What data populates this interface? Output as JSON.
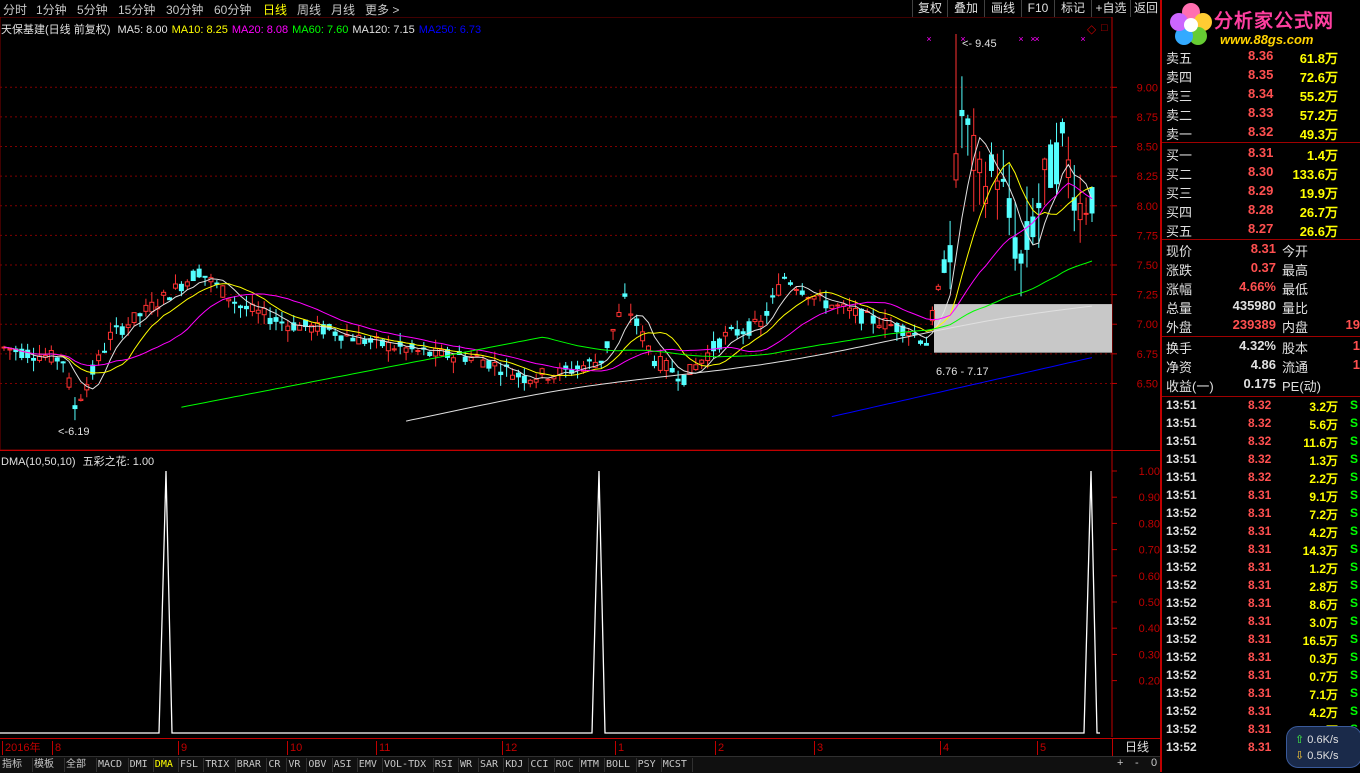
{
  "toolbar": {
    "periods": [
      "分时",
      "1分钟",
      "5分钟",
      "15分钟",
      "30分钟",
      "60分钟",
      "日线",
      "周线",
      "月线",
      "更多 >"
    ],
    "active_period": "日线",
    "buttons": [
      "复权",
      "叠加",
      "画线",
      "F10",
      "标记",
      "+自选",
      "返回"
    ]
  },
  "logo": {
    "title": "分析家公式网",
    "url_text": "www.88gs.com"
  },
  "main_title": {
    "stock": "天保基建(日线 前复权)",
    "ma": [
      {
        "label": "MA5: 8.00",
        "color": "#e0e0e0"
      },
      {
        "label": "MA10: 8.25",
        "color": "#ffff00"
      },
      {
        "label": "MA20: 8.08",
        "color": "#ff00ff"
      },
      {
        "label": "MA60: 7.60",
        "color": "#00ff00"
      },
      {
        "label": "MA120: 7.15",
        "color": "#e0e0e0"
      },
      {
        "label": "MA250: 6.73",
        "color": "#0000ff"
      }
    ]
  },
  "price_axis": [
    "9.00",
    "8.75",
    "8.50",
    "8.25",
    "8.00",
    "7.75",
    "7.50",
    "7.25",
    "7.00",
    "6.75",
    "6.50"
  ],
  "annotations": {
    "high": "9.45",
    "low": "6.19",
    "range": "6.76 - 7.17"
  },
  "indicator": {
    "title": "DMA(10,50,10)",
    "value_label": "五彩之花: 1.00",
    "axis": [
      "1.00",
      "0.90",
      "0.80",
      "0.70",
      "0.60",
      "0.50",
      "0.40",
      "0.30",
      "0.20"
    ]
  },
  "date_axis": [
    "2016年",
    "8",
    "9",
    "10",
    "11",
    "12",
    "1",
    "2",
    "3",
    "4",
    "5"
  ],
  "period_label": "日线",
  "quotes": {
    "asks": [
      {
        "label": "卖五",
        "price": "8.36",
        "vol": "61.8万"
      },
      {
        "label": "卖四",
        "price": "8.35",
        "vol": "72.6万"
      },
      {
        "label": "卖三",
        "price": "8.34",
        "vol": "55.2万"
      },
      {
        "label": "卖二",
        "price": "8.33",
        "vol": "57.2万"
      },
      {
        "label": "卖一",
        "price": "8.32",
        "vol": "49.3万"
      }
    ],
    "bids": [
      {
        "label": "买一",
        "price": "8.31",
        "vol": "1.4万"
      },
      {
        "label": "买二",
        "price": "8.30",
        "vol": "133.6万"
      },
      {
        "label": "买三",
        "price": "8.29",
        "vol": "19.9万"
      },
      {
        "label": "买四",
        "price": "8.28",
        "vol": "26.7万"
      },
      {
        "label": "买五",
        "price": "8.27",
        "vol": "26.6万"
      }
    ],
    "stats": [
      {
        "l1": "现价",
        "v1": "8.31",
        "l2": "今开",
        "v2": ""
      },
      {
        "l1": "涨跌",
        "v1": "0.37",
        "l2": "最高",
        "v2": ""
      },
      {
        "l1": "涨幅",
        "v1": "4.66%",
        "l2": "最低",
        "v2": ""
      },
      {
        "l1": "总量",
        "v1": "435980",
        "l2": "量比",
        "v2": ""
      },
      {
        "l1": "外盘",
        "v1": "239389",
        "l2": "内盘",
        "v2": "19"
      }
    ],
    "info": [
      {
        "l1": "换手",
        "v1": "4.32%",
        "l2": "股本",
        "v2": "1"
      },
      {
        "l1": "净资",
        "v1": "4.86",
        "l2": "流通",
        "v2": "1"
      },
      {
        "l1": "收益(一)",
        "v1": "0.175",
        "l2": "PE(动)",
        "v2": ""
      }
    ]
  },
  "ticks": [
    {
      "time": "13:51",
      "price": "8.32",
      "vol": "3.2万",
      "flag": "S"
    },
    {
      "time": "13:51",
      "price": "8.32",
      "vol": "5.6万",
      "flag": "S"
    },
    {
      "time": "13:51",
      "price": "8.32",
      "vol": "11.6万",
      "flag": "S"
    },
    {
      "time": "13:51",
      "price": "8.32",
      "vol": "1.3万",
      "flag": "S"
    },
    {
      "time": "13:51",
      "price": "8.32",
      "vol": "2.2万",
      "flag": "S"
    },
    {
      "time": "13:51",
      "price": "8.31",
      "vol": "9.1万",
      "flag": "S"
    },
    {
      "time": "13:52",
      "price": "8.31",
      "vol": "7.2万",
      "flag": "S"
    },
    {
      "time": "13:52",
      "price": "8.31",
      "vol": "4.2万",
      "flag": "S"
    },
    {
      "time": "13:52",
      "price": "8.31",
      "vol": "14.3万",
      "flag": "S"
    },
    {
      "time": "13:52",
      "price": "8.31",
      "vol": "1.2万",
      "flag": "S"
    },
    {
      "time": "13:52",
      "price": "8.31",
      "vol": "2.8万",
      "flag": "S"
    },
    {
      "time": "13:52",
      "price": "8.31",
      "vol": "8.6万",
      "flag": "S"
    },
    {
      "time": "13:52",
      "price": "8.31",
      "vol": "3.0万",
      "flag": "S"
    },
    {
      "time": "13:52",
      "price": "8.31",
      "vol": "16.5万",
      "flag": "S"
    },
    {
      "time": "13:52",
      "price": "8.31",
      "vol": "0.3万",
      "flag": "S"
    },
    {
      "time": "13:52",
      "price": "8.31",
      "vol": "0.7万",
      "flag": "S"
    },
    {
      "time": "13:52",
      "price": "8.31",
      "vol": "7.1万",
      "flag": "S"
    },
    {
      "time": "13:52",
      "price": "8.31",
      "vol": "4.2万",
      "flag": "S"
    },
    {
      "time": "13:52",
      "price": "8.31",
      "vol": "3.0万",
      "flag": "S"
    },
    {
      "time": "13:52",
      "price": "8.31",
      "vol": "",
      "flag": ""
    }
  ],
  "net": {
    "up": "0.6K/s",
    "down": "0.5K/s"
  },
  "bottom_tabs": [
    "指标",
    "模板",
    "全部",
    "MACD",
    "DMI",
    "DMA",
    "FSL",
    "TRIX",
    "BRAR",
    "CR",
    "VR",
    "OBV",
    "ASI",
    "EMV",
    "VOL-TDX",
    "RSI",
    "WR",
    "SAR",
    "KDJ",
    "CCI",
    "ROC",
    "MTM",
    "BOLL",
    "PSY",
    "MCST"
  ],
  "active_tab": "DMA",
  "bottom_controls": [
    "+",
    "-",
    "0"
  ],
  "colors": {
    "up": "#ff3232",
    "down": "#54ffff",
    "grid": "#800000",
    "axis": "#c00000"
  }
}
